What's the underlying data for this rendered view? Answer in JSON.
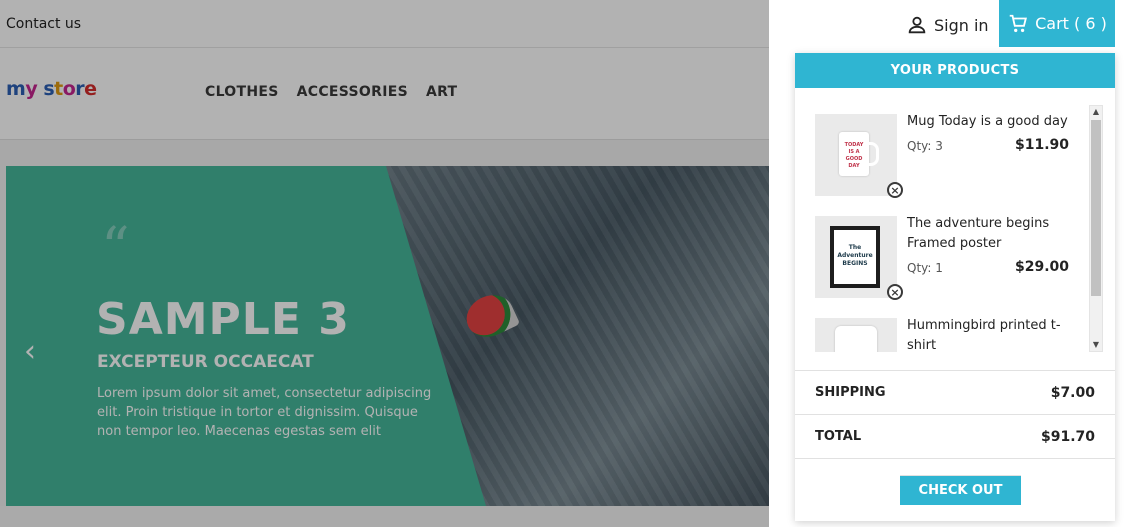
{
  "topbar": {
    "contact": "Contact us",
    "signin": "Sign in",
    "cart_label": "Cart ( 6 )"
  },
  "header": {
    "logo": "my store",
    "nav": [
      "CLOTHES",
      "ACCESSORIES",
      "ART"
    ]
  },
  "slider": {
    "quote": "“",
    "title": "SAMPLE 3",
    "subtitle": "EXCEPTEUR OCCAECAT",
    "text": "Lorem ipsum dolor sit amet, consectetur adipiscing elit. Proin tristique in tortor et dignissim. Quisque non tempor leo. Maecenas egestas sem elit",
    "prev": "‹"
  },
  "cart": {
    "heading": "YOUR PRODUCTS",
    "items": [
      {
        "name": "Mug Today is a good day",
        "qty": "Qty: 3",
        "price": "$11.90",
        "thumb_text": "TODAY IS A GOOD DAY"
      },
      {
        "name": "The adventure begins Framed poster",
        "qty": "Qty: 1",
        "price": "$29.00",
        "thumb_text": "The Adventure BEGINS"
      },
      {
        "name": "Hummingbird printed t-shirt",
        "qty": "",
        "price": ""
      }
    ],
    "shipping_label": "SHIPPING",
    "shipping_value": "$7.00",
    "total_label": "TOTAL",
    "total_value": "$91.70",
    "checkout": "CHECK OUT"
  },
  "colors": {
    "accent": "#2fb5d2",
    "slide_panel": "#45b69a"
  }
}
